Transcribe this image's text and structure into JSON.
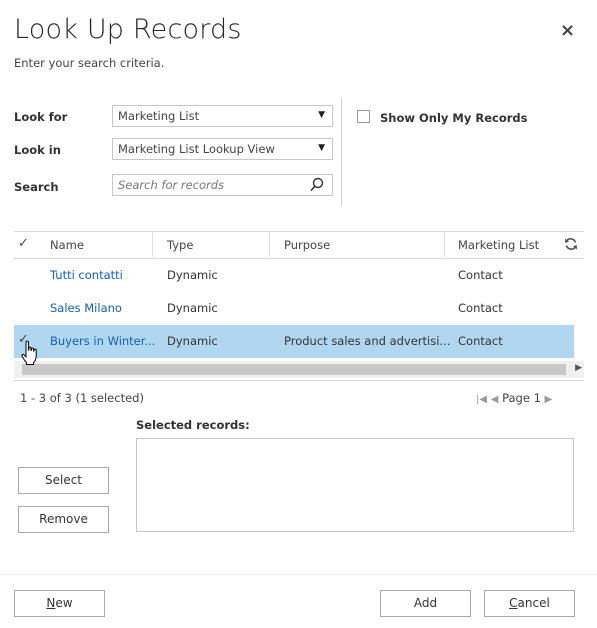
{
  "dialog": {
    "title": "Look Up Records",
    "subtitle": "Enter your search criteria.",
    "close_glyph": "×"
  },
  "form": {
    "look_for_label": "Look for",
    "look_for_value": "Marketing List",
    "look_in_label": "Look in",
    "look_in_value": "Marketing List Lookup View",
    "search_label": "Search",
    "search_placeholder": "Search for records",
    "show_only_mine_label": "Show Only My Records",
    "show_only_mine_checked": false
  },
  "grid": {
    "check_glyph": "✓",
    "columns": [
      "Name",
      "Type",
      "Purpose",
      "Marketing List"
    ],
    "rows": [
      {
        "name": "Tutti contatti",
        "type": "Dynamic",
        "purpose": "",
        "marketing_list": "Contact",
        "selected": false
      },
      {
        "name": "Sales Milano",
        "type": "Dynamic",
        "purpose": "",
        "marketing_list": "Contact",
        "selected": false
      },
      {
        "name": "Buyers in Winter...",
        "type": "Dynamic",
        "purpose": "Product sales and advertisi...",
        "marketing_list": "Contact",
        "selected": true
      }
    ]
  },
  "pager": {
    "summary": "1 - 3 of 3 (1 selected)",
    "page_label": "Page 1"
  },
  "selected_records": {
    "label": "Selected records:"
  },
  "buttons": {
    "select": "Select",
    "remove": "Remove",
    "new": "New",
    "add": "Add",
    "cancel": "Cancel"
  },
  "icons": {
    "refresh": "refresh-icon",
    "search": "magnifier-icon",
    "dropdown": "triangle-down-icon",
    "first_page": "first-page-icon",
    "prev_page": "prev-page-icon",
    "next_page": "next-page-icon",
    "cursor": "hand-pointer-icon"
  },
  "colors": {
    "selected_row": "#b1d6f0",
    "link": "#1160b7"
  }
}
